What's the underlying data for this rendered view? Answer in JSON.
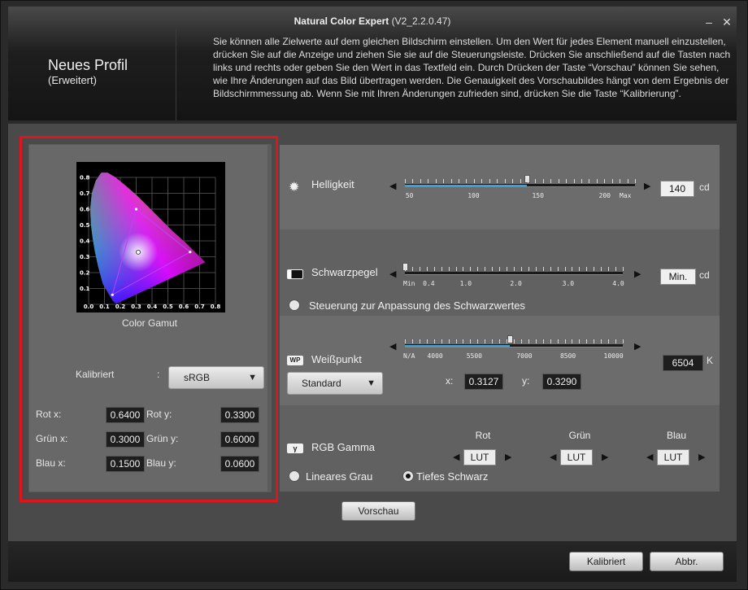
{
  "window": {
    "title_bold": "Natural Color Expert",
    "title_version": "(V2_2.2.0.47)",
    "minimize": "–",
    "close": "✕"
  },
  "header": {
    "title": "Neues Profil",
    "subtitle": "(Erweitert)",
    "instructions": "Sie können alle Zielwerte auf dem gleichen Bildschirm einstellen. Um den Wert für jedes Element manuell einzustellen, drücken Sie auf die Anzeige und ziehen Sie sie auf die Steuerungsleiste. Drücken Sie anschließend auf die Tasten nach links und rechts oder geben Sie den Wert in das Textfeld ein. Durch Drücken der Taste “Vorschau” können Sie sehen, wie Ihre Änderungen auf das Bild übertragen werden. Die Genauigkeit des Vorschaubildes hängt von dem Ergebnis der Bildschirmmessung ab. Wenn Sie mit Ihren Änderungen zufrieden sind, drücken Sie die Taste “Kalibrierung”."
  },
  "gamut": {
    "label": "Color Gamut",
    "axis_ticks": [
      "0.0",
      "0.1",
      "0.2",
      "0.3",
      "0.4",
      "0.5",
      "0.6",
      "0.7",
      "0.8"
    ],
    "y_ticks": [
      "0.1",
      "0.2",
      "0.3",
      "0.4",
      "0.5",
      "0.6",
      "0.7",
      "0.8"
    ],
    "triangle": [
      [
        0.64,
        0.33
      ],
      [
        0.3,
        0.6
      ],
      [
        0.15,
        0.06
      ]
    ],
    "white_point": [
      0.3127,
      0.329
    ]
  },
  "calibration": {
    "label": "Kalibriert",
    "colon": ":",
    "selected": "sRGB"
  },
  "primaries": {
    "red_x_label": "Rot x:",
    "red_x": "0.6400",
    "red_y_label": "Rot y:",
    "red_y": "0.3300",
    "green_x_label": "Grün x:",
    "green_x": "0.3000",
    "green_y_label": "Grün y:",
    "green_y": "0.6000",
    "blue_x_label": "Blau x:",
    "blue_x": "0.1500",
    "blue_y_label": "Blau y:",
    "blue_y": "0.0600"
  },
  "brightness": {
    "label": "Helligkeit",
    "ticks": [
      "50",
      "100",
      "150",
      "200",
      "Max"
    ],
    "value": "140",
    "unit": "cd",
    "level": 0.53
  },
  "black": {
    "label": "Schwarzpegel",
    "ticks": [
      "Min",
      "0.4",
      "1.0",
      "2.0",
      "3.0",
      "4.0"
    ],
    "value": "Min.",
    "unit": "cd",
    "level": 0.0,
    "control_label": "Steuerung zur Anpassung des Schwarzwertes"
  },
  "white": {
    "label": "Weißpunkt",
    "icon_text": "WP",
    "ticks": [
      "N/A",
      "4000",
      "5500",
      "7000",
      "8500",
      "10000"
    ],
    "value": "6504",
    "unit": "K",
    "level": 0.48,
    "preset": "Standard",
    "x_label": "x:",
    "x_value": "0.3127",
    "y_label": "y:",
    "y_value": "0.3290"
  },
  "gamma": {
    "label": "RGB Gamma",
    "icon_text": "γ",
    "red_label": "Rot",
    "red_value": "LUT",
    "green_label": "Grün",
    "green_value": "LUT",
    "blue_label": "Blau",
    "blue_value": "LUT",
    "linear_gray": "Lineares Grau",
    "deep_black": "Tiefes Schwarz"
  },
  "buttons": {
    "preview": "Vorschau",
    "calibrate": "Kalibriert",
    "cancel": "Abbr."
  }
}
